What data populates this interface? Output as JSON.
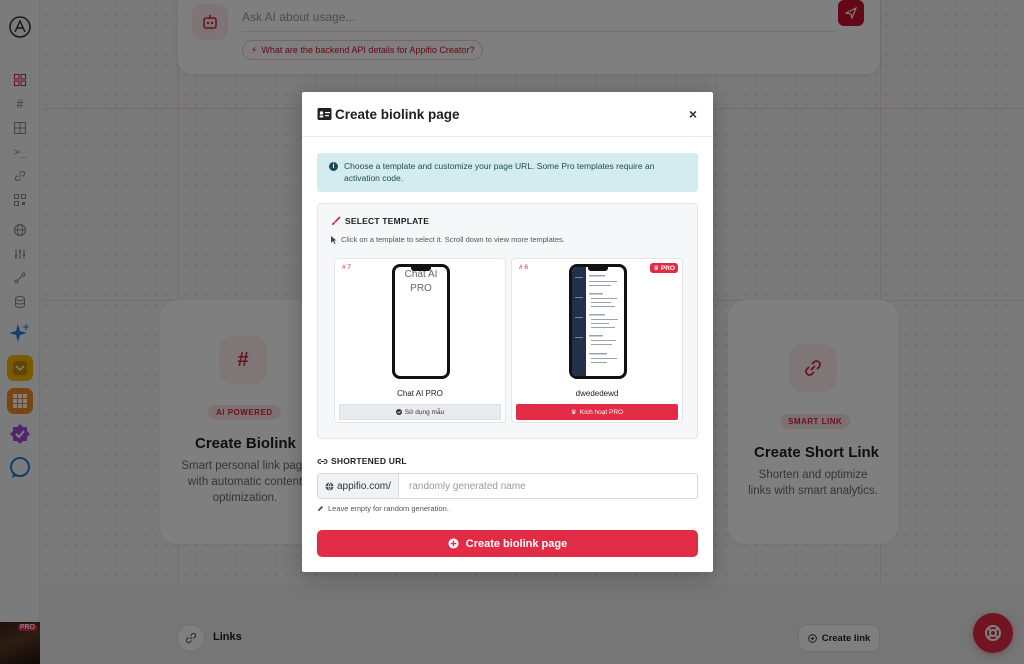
{
  "ai_panel": {
    "placeholder": "Ask AI about usage...",
    "suggestion": "What are the backend API details for Appifio Creator?"
  },
  "features": [
    {
      "badge": "AI POWERED",
      "title": "Create Biolink",
      "description": "Smart personal link page with automatic content optimization.",
      "icon": "hash-icon"
    },
    {
      "badge": "SMART LINK",
      "title": "Create Short Link",
      "description": "Shorten and optimize links with smart analytics.",
      "icon": "link-icon"
    }
  ],
  "links_section": {
    "title": "Links",
    "create_button": "Create link"
  },
  "user": {
    "badge": "PRO"
  },
  "modal": {
    "title": "Create biolink page",
    "close": "×",
    "info": "Choose a template and customize your page URL. Some Pro templates require an activation code.",
    "template_section": {
      "heading": "SELECT TEMPLATE",
      "hint": "Click on a template to select it. Scroll down to view more templates.",
      "templates": [
        {
          "number": "# 7",
          "preview_alt": "Chat AI PRO",
          "name": "Chat AI PRO",
          "button": "Sử dụng mẫu",
          "pro": ""
        },
        {
          "number": "# 6",
          "preview_alt": "",
          "name": "dwededewd",
          "button": "Kích hoạt PRO",
          "pro": "PRO"
        }
      ]
    },
    "url_section": {
      "heading": "SHORTENED URL",
      "prefix": "appifio.com/",
      "placeholder": "randomly generated name",
      "value": "",
      "hint": "Leave empty for random generation."
    },
    "submit": "Create biolink page"
  },
  "colors": {
    "accent": "#e22b44",
    "info_bg": "#d4ecef",
    "info_text": "#1e4a52"
  }
}
